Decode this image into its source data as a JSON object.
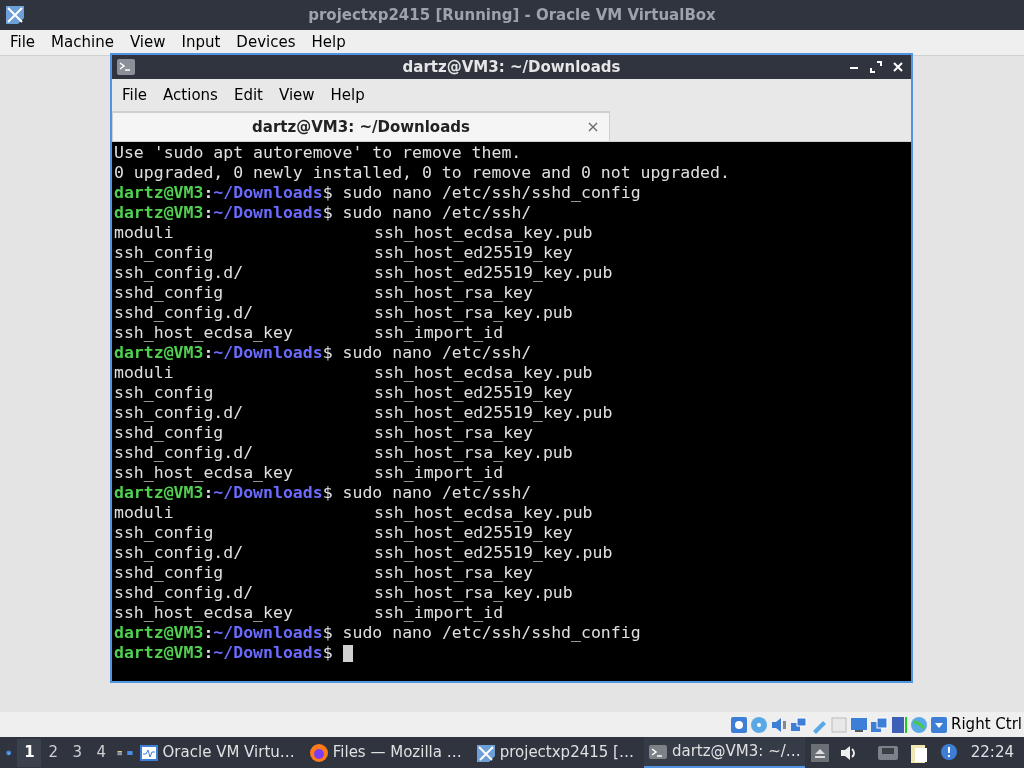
{
  "host_window": {
    "title": "projectxp2415 [Running] - Oracle VM VirtualBox",
    "menu": [
      "File",
      "Machine",
      "View",
      "Input",
      "Devices",
      "Help"
    ]
  },
  "terminal": {
    "title": "dartz@VM3: ~/Downloads",
    "menu": [
      "File",
      "Actions",
      "Edit",
      "View",
      "Help"
    ],
    "tabs": [
      {
        "label": "dartz@VM3: ~/Downloads",
        "selected": true
      }
    ],
    "prompt_separator": ":",
    "prompt_symbol": "$",
    "lines": [
      {
        "kind": "text",
        "text": "Use 'sudo apt autoremove' to remove them."
      },
      {
        "kind": "text",
        "text": "0 upgraded, 0 newly installed, 0 to remove and 0 not upgraded."
      },
      {
        "kind": "prompt",
        "user": "dartz@VM3",
        "path": "~/Downloads",
        "command": "sudo nano /etc/ssh/sshd_config"
      },
      {
        "kind": "prompt",
        "user": "dartz@VM3",
        "path": "~/Downloads",
        "command": "sudo nano /etc/ssh/"
      },
      {
        "kind": "columns",
        "left": "moduli",
        "right": "ssh_host_ecdsa_key.pub"
      },
      {
        "kind": "columns",
        "left": "ssh_config",
        "right": "ssh_host_ed25519_key"
      },
      {
        "kind": "columns",
        "left": "ssh_config.d/",
        "right": "ssh_host_ed25519_key.pub"
      },
      {
        "kind": "columns",
        "left": "sshd_config",
        "right": "ssh_host_rsa_key"
      },
      {
        "kind": "columns",
        "left": "sshd_config.d/",
        "right": "ssh_host_rsa_key.pub"
      },
      {
        "kind": "columns",
        "left": "ssh_host_ecdsa_key",
        "right": "ssh_import_id"
      },
      {
        "kind": "prompt",
        "user": "dartz@VM3",
        "path": "~/Downloads",
        "command": "sudo nano /etc/ssh/"
      },
      {
        "kind": "columns",
        "left": "moduli",
        "right": "ssh_host_ecdsa_key.pub"
      },
      {
        "kind": "columns",
        "left": "ssh_config",
        "right": "ssh_host_ed25519_key"
      },
      {
        "kind": "columns",
        "left": "ssh_config.d/",
        "right": "ssh_host_ed25519_key.pub"
      },
      {
        "kind": "columns",
        "left": "sshd_config",
        "right": "ssh_host_rsa_key"
      },
      {
        "kind": "columns",
        "left": "sshd_config.d/",
        "right": "ssh_host_rsa_key.pub"
      },
      {
        "kind": "columns",
        "left": "ssh_host_ecdsa_key",
        "right": "ssh_import_id"
      },
      {
        "kind": "prompt",
        "user": "dartz@VM3",
        "path": "~/Downloads",
        "command": "sudo nano /etc/ssh/"
      },
      {
        "kind": "columns",
        "left": "moduli",
        "right": "ssh_host_ecdsa_key.pub"
      },
      {
        "kind": "columns",
        "left": "ssh_config",
        "right": "ssh_host_ed25519_key"
      },
      {
        "kind": "columns",
        "left": "ssh_config.d/",
        "right": "ssh_host_ed25519_key.pub"
      },
      {
        "kind": "columns",
        "left": "sshd_config",
        "right": "ssh_host_rsa_key"
      },
      {
        "kind": "columns",
        "left": "sshd_config.d/",
        "right": "ssh_host_rsa_key.pub"
      },
      {
        "kind": "columns",
        "left": "ssh_host_ecdsa_key",
        "right": "ssh_import_id"
      },
      {
        "kind": "prompt",
        "user": "dartz@VM3",
        "path": "~/Downloads",
        "command": "sudo nano /etc/ssh/sshd_config"
      },
      {
        "kind": "prompt",
        "user": "dartz@VM3",
        "path": "~/Downloads",
        "cursor": true
      }
    ]
  },
  "status_bar": {
    "host_key": "Right Ctrl"
  },
  "taskbar": {
    "workspaces": [
      {
        "label": "1",
        "selected": true
      },
      {
        "label": "2",
        "selected": false
      },
      {
        "label": "3",
        "selected": false
      },
      {
        "label": "4",
        "selected": false
      }
    ],
    "tasks": [
      {
        "kind": "monitor",
        "label": "Oracle VM Virtu…",
        "selected": false
      },
      {
        "kind": "browser",
        "label": "Files — Mozilla …",
        "selected": false
      },
      {
        "kind": "vbox",
        "label": "projectxp2415 […",
        "selected": false
      },
      {
        "kind": "terminal",
        "label": "dartz@VM3: ~/…",
        "selected": true
      }
    ],
    "clock": "22:24"
  }
}
